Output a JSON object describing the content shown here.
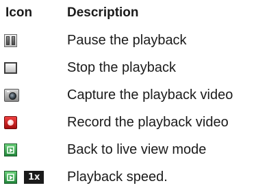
{
  "header": {
    "icon_col": "Icon",
    "desc_col": "Description"
  },
  "rows": [
    {
      "icon": "pause-icon",
      "description": "Pause the playback"
    },
    {
      "icon": "stop-icon",
      "description": "Stop the playback"
    },
    {
      "icon": "capture-camera-icon",
      "description": "Capture the playback video"
    },
    {
      "icon": "record-icon",
      "description": "Record the playback video"
    },
    {
      "icon": "live-view-icon",
      "description": "Back to live view mode"
    },
    {
      "icon": "playback-speed-icon",
      "description": "Playback speed.",
      "badge": "1x"
    }
  ]
}
